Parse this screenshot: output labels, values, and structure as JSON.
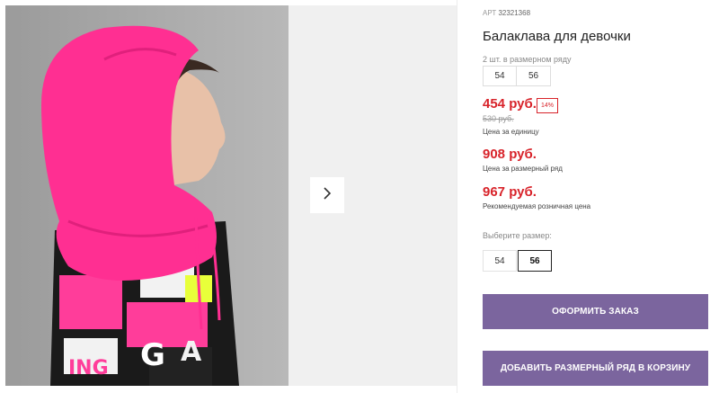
{
  "gallery": {
    "photo_alt": "Балаклава для девочки",
    "next_icon": "chevron-right-icon"
  },
  "product": {
    "art_label": "АРТ",
    "art_number": "32321368",
    "title": "Балаклава для девочки"
  },
  "pack": {
    "label": "2 шт. в размерном ряду",
    "sizes": [
      "54",
      "56"
    ]
  },
  "prices": {
    "unit_price": "454 руб.",
    "discount": "14%",
    "old_price": "530 руб.",
    "unit_label": "Цена за единицу",
    "row_price": "908 руб.",
    "row_label": "Цена за размерный ряд",
    "rrp_price": "967 руб.",
    "rrp_label": "Рекомендуемая розничная цена"
  },
  "size_select": {
    "label": "Выберите размер:",
    "options": [
      "54",
      "56"
    ],
    "selected": "56"
  },
  "actions": {
    "order_label": "ОФОРМИТЬ ЗАКАЗ",
    "cart_label": "ДОБАВИТЬ РАЗМЕРНЫЙ РЯД В КОРЗИНУ"
  },
  "colors": {
    "price_red": "#d8232a",
    "button_purple": "#7b659e",
    "hood_pink": "#ff2f92"
  }
}
